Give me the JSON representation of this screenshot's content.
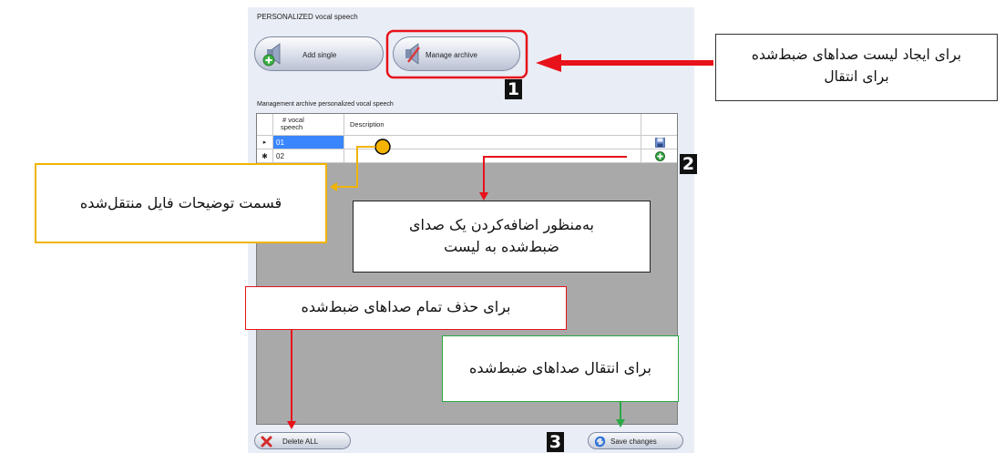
{
  "app": {
    "title": "PERSONALIZED vocal speech",
    "buttons": {
      "add_single": "Add single",
      "manage_archive": "Manage archive"
    },
    "grid": {
      "label": "Management archive personalized vocal speech",
      "columns": {
        "speech_line1": "# vocal",
        "speech_line2": "speech",
        "description": "Description"
      },
      "rows": [
        {
          "marker": "▸",
          "speech": "01",
          "description": ""
        },
        {
          "marker": "✱",
          "speech": "02",
          "description": ""
        }
      ]
    },
    "footer": {
      "delete_all": "Delete ALL",
      "save_changes": "Save changes"
    }
  },
  "annotations": {
    "note1_line1": "برای ایجاد لیست صداهای ضبط‌شده",
    "note1_line2": "برای انتقال",
    "note_description": "قسمت توضیحات فایل منتقل‌شده",
    "note_add_line1": "به‌منظور اضافه‌کردن یک صدای",
    "note_add_line2": "ضبط‌شده به لیست",
    "note_delete": "برای حذف تمام صداهای ضبط‌شده",
    "note_transfer": "برای انتقال صداهای ضبط‌شده",
    "badge1": "1",
    "badge2": "2",
    "badge3": "3"
  },
  "colors": {
    "red": "#e8121a",
    "yellow": "#f0b400",
    "green": "#2aa845",
    "selected_cell": "#3a86ff"
  }
}
